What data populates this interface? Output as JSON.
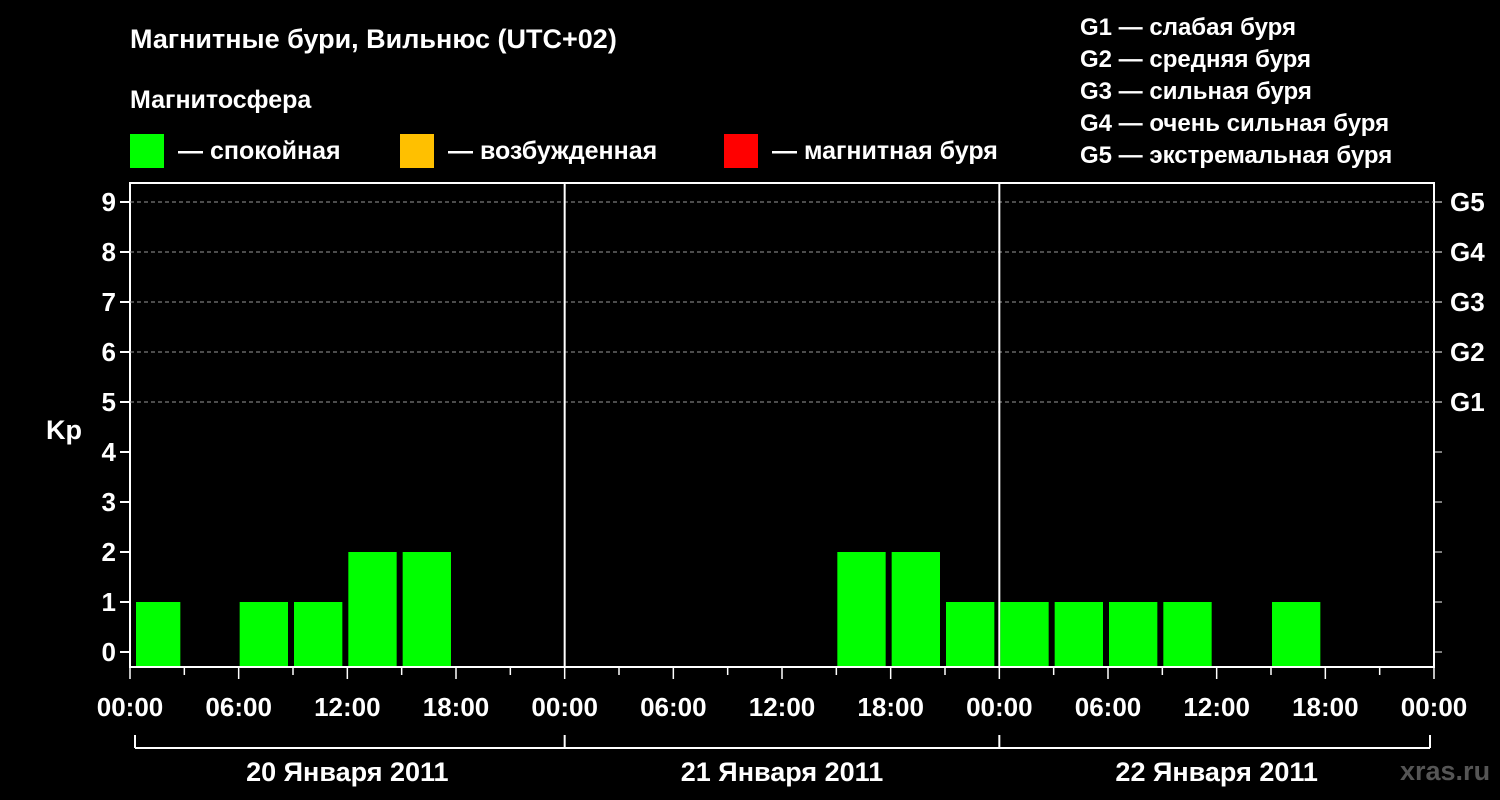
{
  "title": "Магнитные бури, Вильнюс (UTC+02)",
  "magnetosphere": {
    "title": "Магнитосфера",
    "legend": [
      {
        "label": "— спокойная",
        "color": "#00ff00"
      },
      {
        "label": "— возбужденная",
        "color": "#ffc000"
      },
      {
        "label": "— магнитная буря",
        "color": "#ff0000"
      }
    ]
  },
  "g_scale": [
    "G1 — слабая буря",
    "G2 — средняя буря",
    "G3 — сильная буря",
    "G4 — очень сильная буря",
    "G5 — экстремальная буря"
  ],
  "watermark": "xras.ru",
  "chart_data": {
    "type": "bar",
    "ylabel": "Kp",
    "ylim": [
      0,
      9
    ],
    "yticks": [
      0,
      1,
      2,
      3,
      4,
      5,
      6,
      7,
      8,
      9
    ],
    "right_ticks": [
      {
        "value": 5,
        "label": "G1"
      },
      {
        "value": 6,
        "label": "G2"
      },
      {
        "value": 7,
        "label": "G3"
      },
      {
        "value": 8,
        "label": "G4"
      },
      {
        "value": 9,
        "label": "G5"
      }
    ],
    "x_tick_labels": [
      "00:00",
      "06:00",
      "12:00",
      "18:00",
      "00:00",
      "06:00",
      "12:00",
      "18:00",
      "00:00",
      "06:00",
      "12:00",
      "18:00",
      "00:00"
    ],
    "days": [
      "20 Января 2011",
      "21 Января 2011",
      "22 Января 2011"
    ],
    "interval_hours": 3,
    "values": [
      1,
      0,
      1,
      1,
      2,
      2,
      0,
      0,
      0,
      0,
      0,
      0,
      0,
      2,
      2,
      1,
      1,
      1,
      1,
      1,
      0,
      1,
      0,
      0
    ],
    "grid": true,
    "color_quiet": "#00ff00"
  }
}
